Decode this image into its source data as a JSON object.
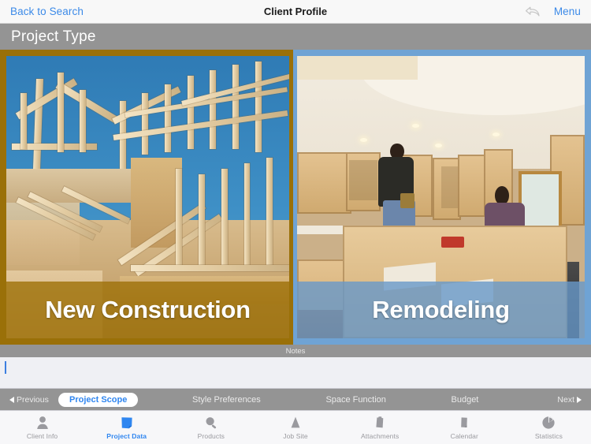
{
  "topbar": {
    "back_label": "Back to Search",
    "title": "Client Profile",
    "undo_icon": "undo-arrow-icon",
    "menu_label": "Menu"
  },
  "section": {
    "title": "Project Type"
  },
  "cards": [
    {
      "id": "new-construction",
      "label": "New Construction",
      "photo_alt": "wood roof truss framing against blue sky",
      "border_color": "#9a7008",
      "overlay_color": "#9e7107"
    },
    {
      "id": "remodeling",
      "label": "Remodeling",
      "photo_alt": "two workers remodeling a kitchen with light wood cabinets",
      "border_color": "#6fa3d4",
      "overlay_color": "#6899c9"
    }
  ],
  "notes": {
    "header_label": "Notes",
    "value": "",
    "caret_visible": true
  },
  "segments": {
    "previous_label": "Previous",
    "next_label": "Next",
    "items": [
      {
        "label": "Project Scope",
        "active": true
      },
      {
        "label": "Style Preferences",
        "active": false
      },
      {
        "label": "Space Function",
        "active": false
      },
      {
        "label": "Budget",
        "active": false
      }
    ]
  },
  "tabbar": {
    "items": [
      {
        "label": "Client Info",
        "icon": "person-icon",
        "active": false
      },
      {
        "label": "Project Data",
        "icon": "note-icon",
        "active": true
      },
      {
        "label": "Products",
        "icon": "magnifier-icon",
        "active": false
      },
      {
        "label": "Job Site",
        "icon": "cone-icon",
        "active": false
      },
      {
        "label": "Attachments",
        "icon": "clipboard-icon",
        "active": false
      },
      {
        "label": "Calendar",
        "icon": "page-icon",
        "active": false
      },
      {
        "label": "Statistics",
        "icon": "pie-chart-icon",
        "active": false
      }
    ]
  },
  "colors": {
    "accent_blue": "#2f86f0",
    "link_blue": "#3c8ae8",
    "header_gray": "#949494",
    "tabbar_bg": "#f7f7f9"
  }
}
